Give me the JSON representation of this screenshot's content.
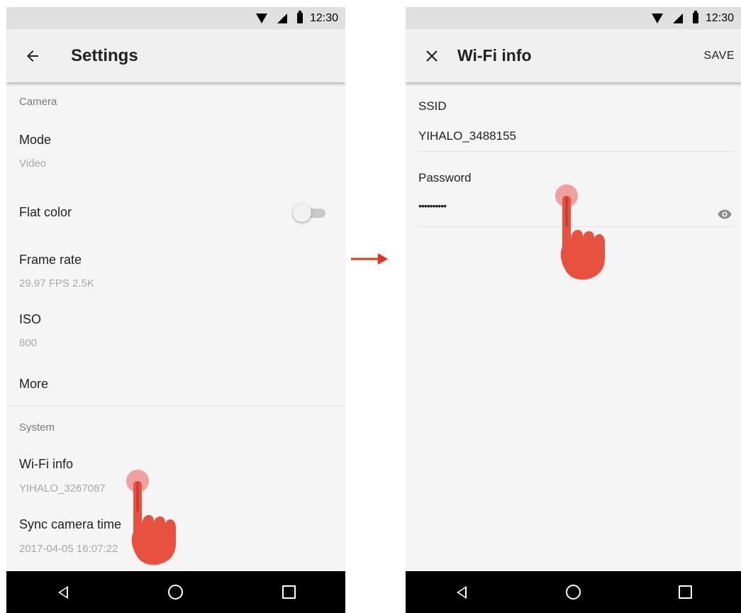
{
  "status_bar": {
    "time": "12:30"
  },
  "settings_screen": {
    "title": "Settings",
    "sections": [
      {
        "header": "Camera"
      },
      {
        "header": "System"
      }
    ],
    "items": {
      "mode": {
        "title": "Mode",
        "value": "Video"
      },
      "flat_color": {
        "title": "Flat color",
        "toggle_on": false
      },
      "frame_rate": {
        "title": "Frame rate",
        "value": "29.97 FPS 2.5K"
      },
      "iso": {
        "title": "ISO",
        "value": "800"
      },
      "more": {
        "title": "More"
      },
      "wifi_info": {
        "title": "Wi-Fi info",
        "value": "YIHALO_3267087"
      },
      "sync_time": {
        "title": "Sync camera time",
        "value": "2017-04-05 16:07:22"
      }
    }
  },
  "wifi_screen": {
    "title": "Wi-Fi info",
    "save_label": "SAVE",
    "ssid": {
      "label": "SSID",
      "value": "YIHALO_3488155"
    },
    "password": {
      "label": "Password",
      "value": "••••••••••"
    }
  },
  "colors": {
    "accent_red": "#e8503f",
    "touch_dot": "#f09090",
    "screen_bg": "#f5f5f5",
    "appbar_bg": "#f0f0f0",
    "statusbar_bg": "#e0e0e0",
    "navbar_bg": "#000000"
  },
  "icons": {
    "back": "arrow-left-icon",
    "close": "close-icon",
    "eye": "eye-icon",
    "nav_back": "nav-back-icon",
    "nav_home": "nav-home-icon",
    "nav_recents": "nav-recents-icon"
  }
}
